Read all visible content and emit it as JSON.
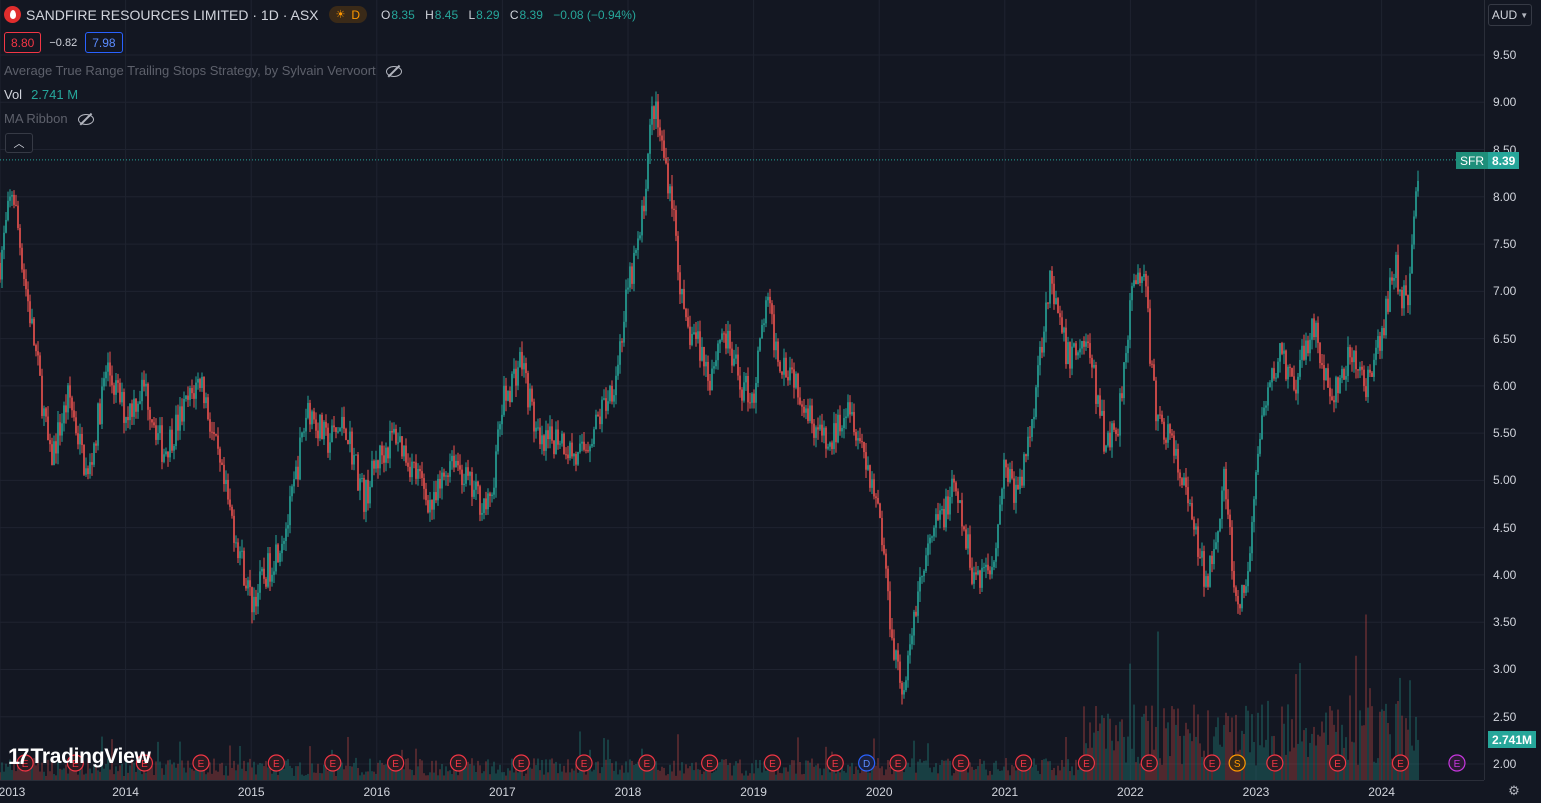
{
  "header": {
    "title": "SANDFIRE RESOURCES LIMITED · 1D · ASX",
    "session_badge": "D",
    "ohlc": {
      "o_label": "O",
      "o": "8.35",
      "h_label": "H",
      "h": "8.45",
      "l_label": "L",
      "l": "8.29",
      "c_label": "C",
      "c": "8.39",
      "change": "−0.08 (−0.94%)"
    },
    "sell_price": "8.80",
    "spread": "−0.82",
    "buy_price": "7.98"
  },
  "indicators": {
    "strategy": "Average True Range Trailing Stops Strategy, by Sylvain Vervoort",
    "vol_label": "Vol",
    "vol_value": "2.741 M",
    "ma_ribbon": "MA Ribbon"
  },
  "price_axis": {
    "currency": "AUD",
    "ticks": [
      "9.50",
      "9.00",
      "8.50",
      "8.00",
      "7.50",
      "7.00",
      "6.50",
      "6.00",
      "5.50",
      "5.00",
      "4.50",
      "4.00",
      "3.50",
      "3.00",
      "2.50",
      "2.00"
    ],
    "symbol_tag": "SFR",
    "last_price_tag": "8.39",
    "volume_tag": "2.741M"
  },
  "time_axis": {
    "ticks": [
      "2013",
      "2014",
      "2015",
      "2016",
      "2017",
      "2018",
      "2019",
      "2020",
      "2021",
      "2022",
      "2023",
      "2024"
    ]
  },
  "brand": {
    "name": "TradingView"
  },
  "colors": {
    "up": "#26a69a",
    "down": "#ef5350",
    "background": "#131722",
    "grid": "#1f2330"
  },
  "icons": {
    "settings": "gear-icon",
    "collapse": "chevron-up-icon",
    "visibility": "eye-off-icon"
  },
  "chart_data": {
    "type": "candlestick",
    "title": "SANDFIRE RESOURCES LIMITED · 1D · ASX",
    "ylabel": "AUD",
    "ylim": [
      1.9,
      9.6
    ],
    "xlim": [
      2013.0,
      2024.7
    ],
    "last_price": 8.39,
    "grid": true,
    "x": [
      2013.0,
      2013.1,
      2013.2,
      2013.3,
      2013.4,
      2013.55,
      2013.7,
      2013.85,
      2014.0,
      2014.15,
      2014.3,
      2014.45,
      2014.6,
      2014.75,
      2014.9,
      2015.0,
      2015.15,
      2015.3,
      2015.45,
      2015.6,
      2015.75,
      2015.9,
      2016.0,
      2016.15,
      2016.3,
      2016.45,
      2016.6,
      2016.75,
      2016.9,
      2017.0,
      2017.15,
      2017.3,
      2017.45,
      2017.6,
      2017.75,
      2017.9,
      2018.0,
      2018.1,
      2018.2,
      2018.35,
      2018.45,
      2018.55,
      2018.65,
      2018.75,
      2018.9,
      2019.0,
      2019.1,
      2019.2,
      2019.3,
      2019.45,
      2019.6,
      2019.75,
      2019.9,
      2020.0,
      2020.1,
      2020.2,
      2020.3,
      2020.45,
      2020.6,
      2020.75,
      2020.9,
      2021.0,
      2021.1,
      2021.2,
      2021.35,
      2021.5,
      2021.65,
      2021.8,
      2021.9,
      2022.0,
      2022.1,
      2022.2,
      2022.3,
      2022.45,
      2022.6,
      2022.75,
      2022.85,
      2022.95,
      2023.0,
      2023.1,
      2023.2,
      2023.3,
      2023.45,
      2023.6,
      2023.75,
      2023.9,
      2024.0,
      2024.1,
      2024.2,
      2024.3
    ],
    "close": [
      7.3,
      8.1,
      7.1,
      6.2,
      5.2,
      5.9,
      5.0,
      6.2,
      5.7,
      6.0,
      5.3,
      5.7,
      6.1,
      5.1,
      4.3,
      3.7,
      4.1,
      4.6,
      5.8,
      5.4,
      5.6,
      4.8,
      5.2,
      5.5,
      5.1,
      4.7,
      5.3,
      4.9,
      4.7,
      5.8,
      6.3,
      5.3,
      5.5,
      5.2,
      5.6,
      6.1,
      7.0,
      7.6,
      9.0,
      8.0,
      6.6,
      6.5,
      6.1,
      6.6,
      6.0,
      5.9,
      6.9,
      6.3,
      6.2,
      5.7,
      5.3,
      5.9,
      5.2,
      4.7,
      3.4,
      2.7,
      3.8,
      4.5,
      4.9,
      4.0,
      4.1,
      5.2,
      4.8,
      5.5,
      7.1,
      6.3,
      6.5,
      5.4,
      5.6,
      6.9,
      7.3,
      5.7,
      5.5,
      4.8,
      3.9,
      5.0,
      3.5,
      4.1,
      5.2,
      5.9,
      6.4,
      5.9,
      6.7,
      5.8,
      6.3,
      6.0,
      6.5,
      7.3,
      6.8,
      8.39
    ]
  }
}
